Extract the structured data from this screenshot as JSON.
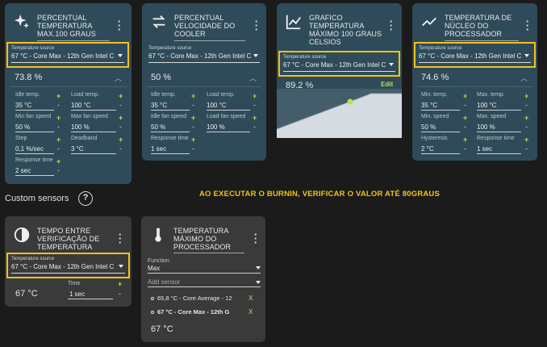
{
  "cards": [
    {
      "title": "PERCENTUAL TEMPERATURA MAX.100 GRAUS",
      "title_lines": [
        "PERCENTUAL",
        "TEMPERATURA",
        "MAX.100 GRAUS"
      ],
      "source_label": "Temperature source",
      "source_value": "67 °C - Core Max - 12th Gen Intel C",
      "value": "73.8 %",
      "fields": [
        {
          "label": "Idle temp.",
          "value": "35 °C"
        },
        {
          "label": "Load temp.",
          "value": "100 °C"
        },
        {
          "label": "Min fan speed",
          "value": "50 %"
        },
        {
          "label": "Max fan speed",
          "value": "100 %"
        },
        {
          "label": "Step",
          "value": "0,1 %/sec"
        },
        {
          "label": "Deadband",
          "value": "3 °C"
        },
        {
          "label": "Response time",
          "value": "2 sec"
        }
      ]
    },
    {
      "title": "PERCENTUAL VELOCIDADE DO COOLER",
      "title_lines": [
        "PERCENTUAL",
        "VELOCIDADE DO",
        "COOLER"
      ],
      "source_label": "Temperature source",
      "source_value": "67 °C - Core Max - 12th Gen Intel C",
      "value": "50 %",
      "fields": [
        {
          "label": "Idle temp.",
          "value": "35 °C"
        },
        {
          "label": "Load temp.",
          "value": "100 °C"
        },
        {
          "label": "Idle fan speed",
          "value": "50 %"
        },
        {
          "label": "Load fan speed",
          "value": "100 %"
        },
        {
          "label": "Response time",
          "value": "1 sec"
        }
      ]
    },
    {
      "title": "GRAFICO TEMPERATURA MÁXIMO 100 GRAUS CELSIOS",
      "title_lines": [
        "GRAFICO",
        "TEMPERATURA",
        "MÁXIMO 100 GRAUS",
        "CELSIOS"
      ],
      "source_label": "Temperature source",
      "source_value": "67 °C - Core Max - 12th Gen Intel C",
      "value": "89.2 %",
      "edit_label": "Edit"
    },
    {
      "title": "TEMPERATURA DE NÚCLEO DO PROCESSADOR",
      "title_lines": [
        "TEMPERATURA DE",
        "NÚCLEO DO",
        "PROCESSADOR"
      ],
      "source_label": "Temperature source",
      "source_value": "67 °C - Core Max - 12th Gen Intel C",
      "value": "74.6 %",
      "fields": [
        {
          "label": "Min. temp.",
          "value": "35 °C"
        },
        {
          "label": "Max. temp.",
          "value": "100 °C"
        },
        {
          "label": "Min. speed",
          "value": "50 %"
        },
        {
          "label": "Max. speed",
          "value": "100 %"
        },
        {
          "label": "Hysteresis",
          "value": "2 °C"
        },
        {
          "label": "Response time",
          "value": "1 sec"
        }
      ]
    }
  ],
  "custom_sensors": {
    "title": "Custom sensors",
    "help": "?",
    "banner": "AO EXECUTAR O BURNIN, VERIFICAR O VALOR ATÉ 80GRAUS",
    "cards": [
      {
        "title": "TEMPO ENTRE VERIFICAÇÃO DE TEMPERATURA",
        "title_lines": [
          "TEMPO ENTRE",
          "VERIFICAÇÃO DE",
          "TEMPERATURA"
        ],
        "source_label": "Temperature source",
        "source_value": "67 °C - Core Max - 12th Gen Intel C",
        "value": "67 °C",
        "time_label": "Time",
        "time_value": "1 sec"
      },
      {
        "title": "TEMPERATURA MÁXIMO DO PROCESSADOR",
        "title_lines": [
          "TEMPERATURA",
          "MÁXIMO DO",
          "PROCESSADOR"
        ],
        "function_label": "Function",
        "function_value": "Max",
        "add_sensor": "Add sensor",
        "sensors": [
          "65,8 °C - Core Average - 12",
          "67 °C - Core Max - 12th G"
        ],
        "remove": "X",
        "value": "67 °C"
      }
    ]
  },
  "colors": {
    "highlight": "#f2c21b",
    "accent": "#b8e04a",
    "card_teal": "#2f4b5a",
    "card_grey": "#3a3a3a"
  },
  "icons": [
    "sparkle-icon",
    "swap-arrows-icon",
    "chart-line-icon",
    "trend-icon",
    "clock-icon",
    "thermometer-icon",
    "help-icon",
    "kebab-menu-icon"
  ]
}
